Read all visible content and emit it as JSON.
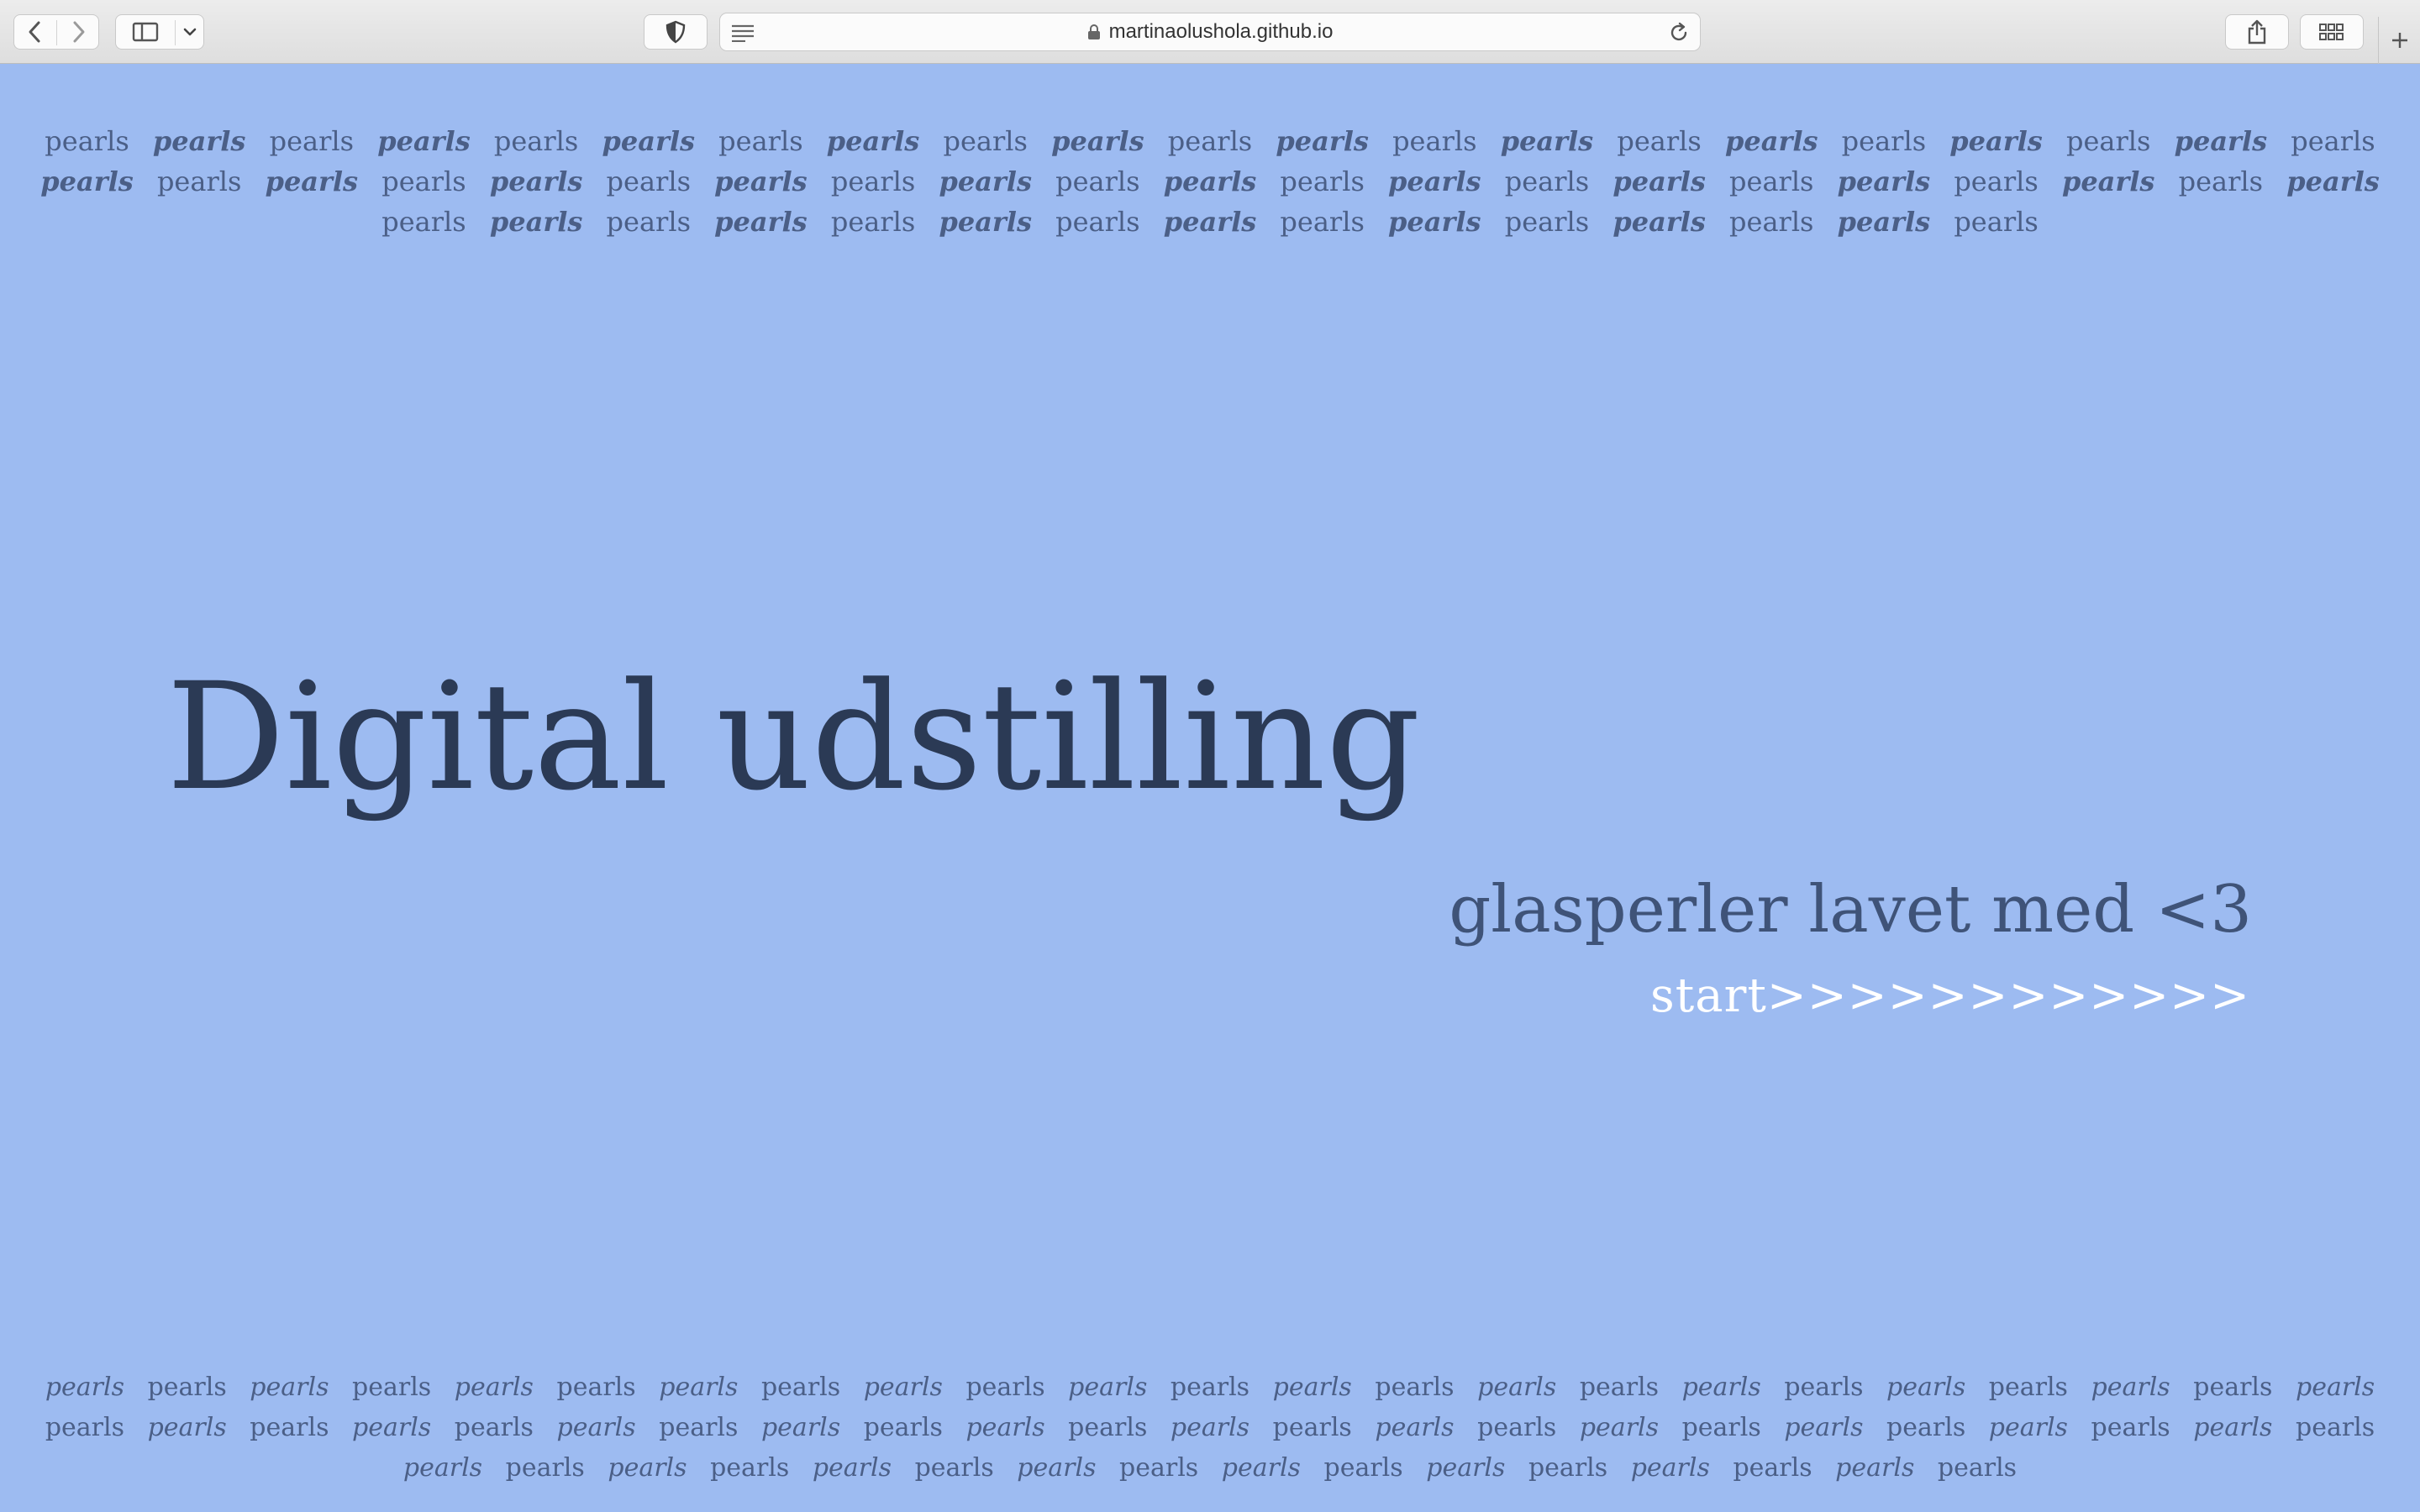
{
  "browser": {
    "url": "martinaolushola.github.io",
    "icons": {
      "back": "chevron-left-icon",
      "forward": "chevron-right-icon",
      "sidebar": "sidebar-icon",
      "sidebar_menu": "chevron-down-icon",
      "privacy": "shield-icon",
      "reader": "reader-icon",
      "lock": "lock-icon",
      "reload": "reload-icon",
      "share": "share-icon",
      "tab_overview": "tab-grid-icon",
      "new_tab": "plus-icon"
    }
  },
  "page": {
    "background_color": "#9dbbf1",
    "title": "Digital udstilling",
    "subtitle": "glasperler lavet med <3",
    "start_link": "start>>>>>>>>>>>>",
    "pearl_word": "pearls",
    "top_pearl_count": 57,
    "bottom_pearl_count": 62
  }
}
